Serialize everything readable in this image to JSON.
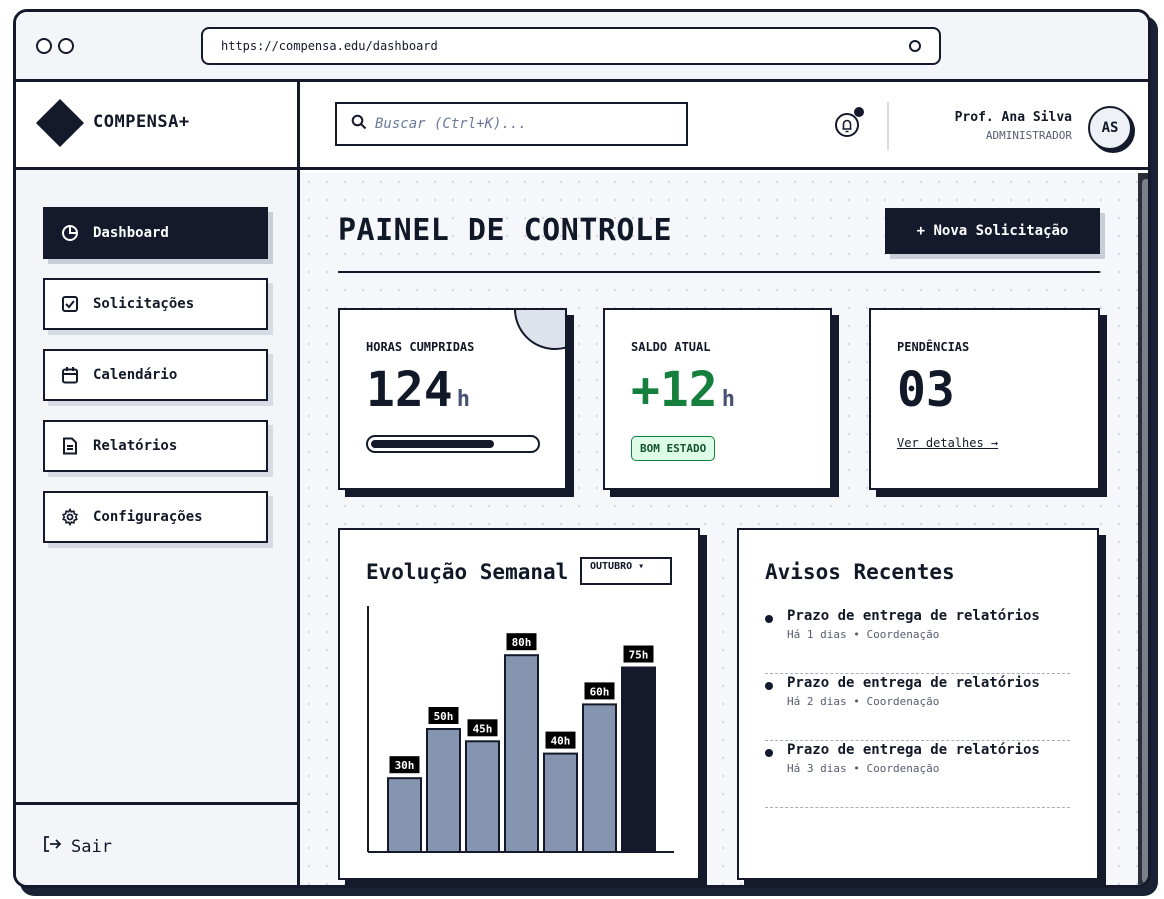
{
  "browser": {
    "url": "https://compensa.edu/dashboard"
  },
  "brand": {
    "name": "COMPENSA+"
  },
  "sidebar": {
    "items": [
      {
        "label": "Dashboard",
        "icon": "pie-chart-icon",
        "active": true
      },
      {
        "label": "Solicitações",
        "icon": "checkbox-icon",
        "active": false
      },
      {
        "label": "Calendário",
        "icon": "calendar-icon",
        "active": false
      },
      {
        "label": "Relatórios",
        "icon": "document-icon",
        "active": false
      },
      {
        "label": "Configurações",
        "icon": "gear-icon",
        "active": false
      }
    ],
    "logout_label": "Sair"
  },
  "header": {
    "search_placeholder": "Buscar (Ctrl+K)...",
    "user_name": "Prof. Ana Silva",
    "user_role": "ADMINISTRADOR",
    "avatar_initials": "AS"
  },
  "main": {
    "title": "PAINEL DE CONTROLE",
    "new_button": "+ Nova Solicitação",
    "stats": {
      "hours": {
        "label": "HORAS CUMPRIDAS",
        "value": "124",
        "unit": "h",
        "progress": 0.75
      },
      "balance": {
        "label": "SALDO ATUAL",
        "value": "+12",
        "unit": "h",
        "badge": "BOM ESTADO"
      },
      "pending": {
        "label": "PENDÊNCIAS",
        "value": "03",
        "link": "Ver detalhes →"
      }
    },
    "weekly": {
      "title": "Evolução Semanal",
      "month": "OUTUBRO ▾"
    },
    "notices": {
      "title": "Avisos Recentes",
      "items": [
        {
          "title": "Prazo de entrega de relatórios",
          "meta": "Há 1 dias • Coordenação"
        },
        {
          "title": "Prazo de entrega de relatórios",
          "meta": "Há 2 dias • Coordenação"
        },
        {
          "title": "Prazo de entrega de relatórios",
          "meta": "Há 3 dias • Coordenação"
        }
      ]
    }
  },
  "colors": {
    "ink": "#141a2b",
    "bar": "#8595b0",
    "bar_highlight": "#141a2b",
    "positive": "#15803d",
    "badge_bg": "#dcfce7"
  },
  "chart_data": {
    "type": "bar",
    "values": [
      30,
      50,
      45,
      80,
      40,
      60,
      75
    ],
    "data_labels": [
      "30h",
      "50h",
      "45h",
      "80h",
      "40h",
      "60h",
      "75h"
    ],
    "ylim": [
      0,
      100
    ],
    "highlight_index": 6,
    "grid": false
  }
}
